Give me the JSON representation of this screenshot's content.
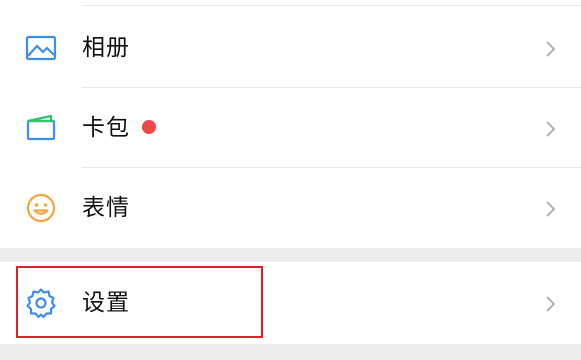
{
  "menu": {
    "items": [
      {
        "label": "相册",
        "icon": "photo-album-icon"
      },
      {
        "label": "卡包",
        "icon": "card-wallet-icon",
        "badge": true
      },
      {
        "label": "表情",
        "icon": "emoji-smile-icon"
      },
      {
        "label": "设置",
        "icon": "gear-icon",
        "highlighted": true
      }
    ]
  },
  "colors": {
    "icon_blue": "#3d8ef0",
    "icon_green": "#33c26c",
    "icon_orange": "#f5a441",
    "badge_red": "#f04848",
    "highlight_red": "#d9222a",
    "chevron": "#b2b2b2"
  }
}
